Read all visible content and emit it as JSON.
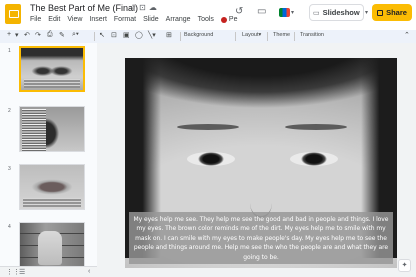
{
  "header": {
    "doc_title": "The Best Part of Me (Final)",
    "title_icons": [
      "star-icon",
      "folder-icon",
      "cloud-icon"
    ],
    "menus": [
      "File",
      "Edit",
      "View",
      "Insert",
      "Format",
      "Slide",
      "Arrange",
      "Tools"
    ],
    "extension_menu_label": "Pe",
    "slideshow_label": "Slideshow",
    "share_label": "Share"
  },
  "toolbar": {
    "items": [
      "new-slide-icon",
      "undo-icon",
      "redo-icon",
      "print-icon",
      "paint-format-icon",
      "zoom-icon",
      "select-icon",
      "textbox-icon",
      "image-icon",
      "shape-icon",
      "line-icon",
      "comment-icon"
    ],
    "background_label": "Background",
    "layout_label": "Layout",
    "theme_label": "Theme",
    "transition_label": "Transition"
  },
  "filmstrip": {
    "slides": [
      {
        "number": "1",
        "selected": true
      },
      {
        "number": "2",
        "selected": false
      },
      {
        "number": "3",
        "selected": false
      },
      {
        "number": "4",
        "selected": false
      }
    ]
  },
  "slide": {
    "caption": "My eyes help me see. They help me see the good and bad in people and things. I love my eyes. The brown color reminds me of the dirt. My eyes help me to smile with my mask on. I can smile with my eyes to make people's day. My eyes help me to see the people and things around me. Help me see the who the people are and what they are going to be."
  }
}
